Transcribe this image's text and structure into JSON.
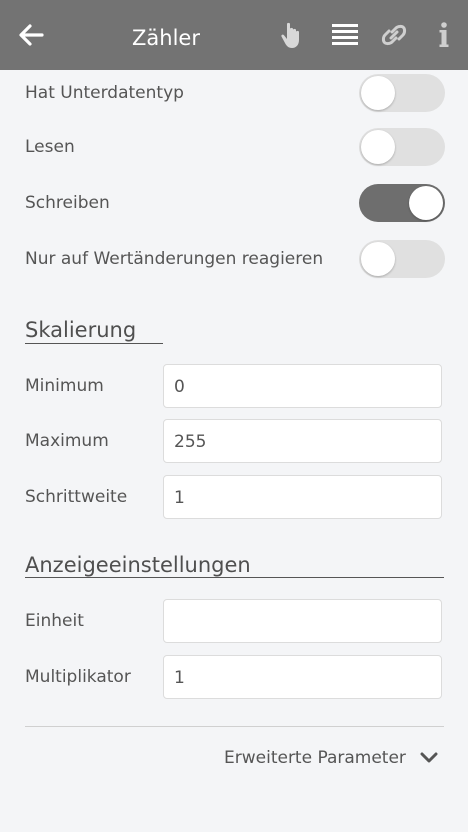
{
  "header": {
    "title": "Zähler",
    "icons": [
      "back-arrow-icon",
      "hand-pointer-icon",
      "list-icon",
      "link-icon",
      "info-icon"
    ]
  },
  "toggles": [
    {
      "label": "Hat Unterdatentyp",
      "on": false
    },
    {
      "label": "Lesen",
      "on": false
    },
    {
      "label": "Schreiben",
      "on": true
    },
    {
      "label": "Nur auf Wertänderungen reagieren",
      "on": false
    }
  ],
  "scaling": {
    "title": "Skalierung",
    "fields": [
      {
        "label": "Minimum",
        "value": "0"
      },
      {
        "label": "Maximum",
        "value": "255"
      },
      {
        "label": "Schrittweite",
        "value": "1"
      }
    ]
  },
  "display": {
    "title": "Anzeigeeinstellungen",
    "fields": [
      {
        "label": "Einheit",
        "value": ""
      },
      {
        "label": "Multiplikator",
        "value": "1"
      }
    ]
  },
  "advanced": {
    "label": "Erweiterte Parameter"
  },
  "colors": {
    "header_bg": "#737373",
    "toggle_on": "#6e6e6e",
    "toggle_off": "#e0e0e0",
    "page_bg": "#f4f5f7"
  }
}
